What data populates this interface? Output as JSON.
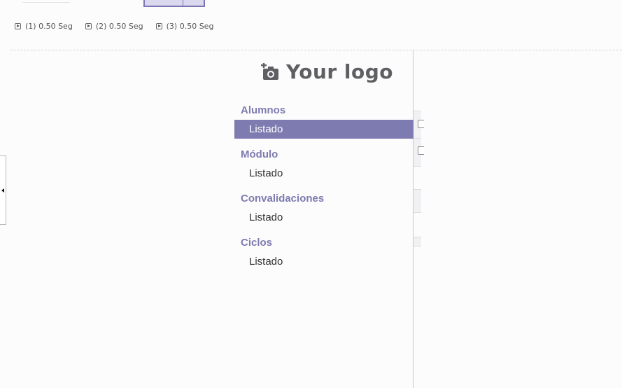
{
  "steps": [
    {
      "label": "(1) 0.50 Seg"
    },
    {
      "label": "(2) 0.50 Seg"
    },
    {
      "label": "(3) 0.50 Seg"
    }
  ],
  "logo": {
    "text": "Your logo",
    "icon": "add-photo-icon"
  },
  "menu": [
    {
      "heading": "Alumnos",
      "item": "Listado",
      "active": true
    },
    {
      "heading": "Módulo",
      "item": "Listado",
      "active": false
    },
    {
      "heading": "Convalidaciones",
      "item": "Listado",
      "active": false
    },
    {
      "heading": "Ciclos",
      "item": "Listado",
      "active": false
    }
  ],
  "colors": {
    "accent": "#7e7bb0",
    "logo": "#5f5f63",
    "text": "#333333"
  }
}
